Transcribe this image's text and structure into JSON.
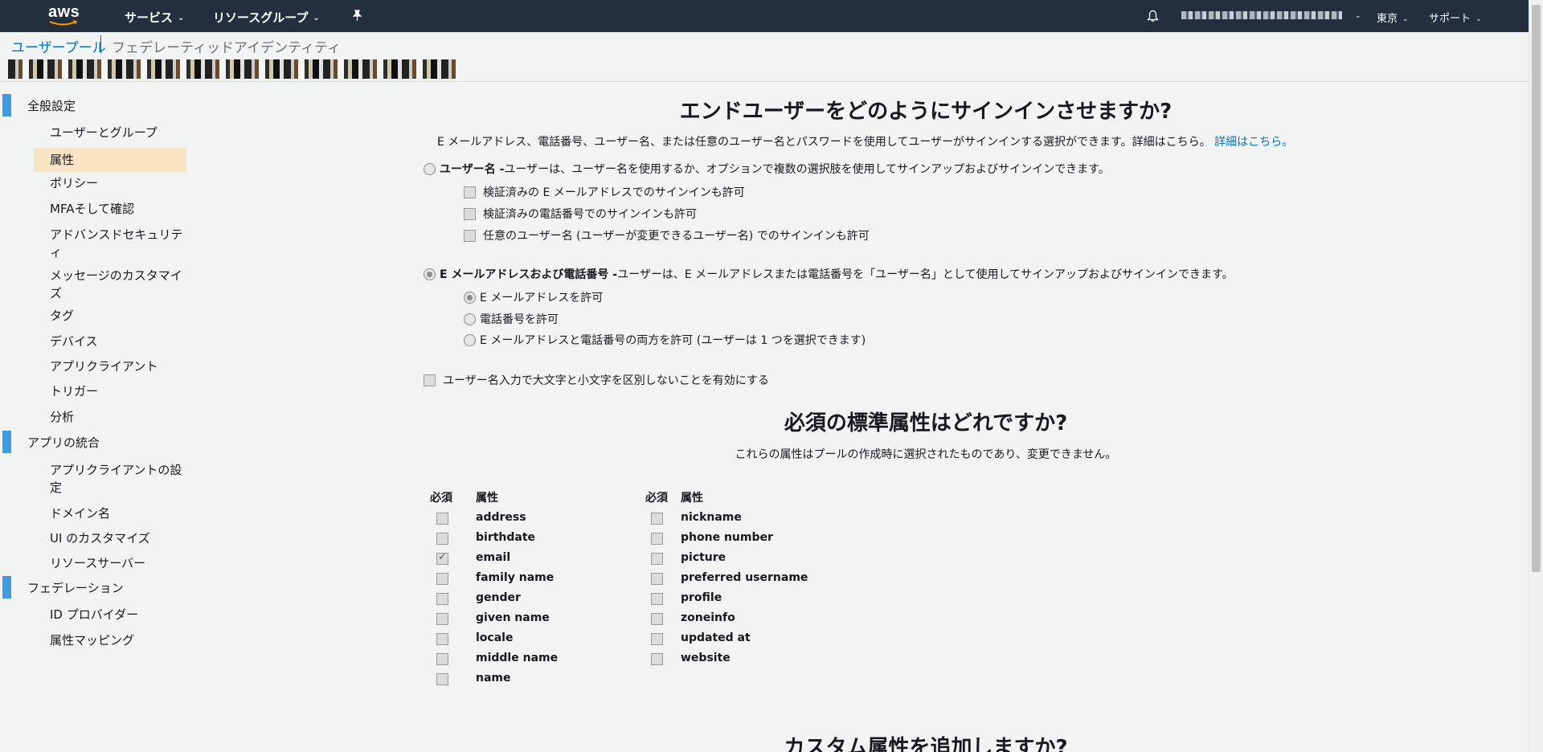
{
  "topnav": {
    "logo_text": "aws",
    "services": "サービス",
    "resource_groups": "リソースグループ",
    "region": "東京",
    "support": "サポート",
    "icons": [
      "pin-icon",
      "bell-icon"
    ]
  },
  "breadcrumb": {
    "user_pools": "ユーザープール",
    "federated_identities": "フェデレーティッドアイデンティティ"
  },
  "sidebar": {
    "group1": "全般設定",
    "group1_items": [
      "ユーザーとグループ",
      "属性",
      "ポリシー",
      "MFAそして確認",
      "アドバンスドセキュリティ",
      "メッセージのカスタマイズ",
      "タグ",
      "デバイス",
      "アプリクライアント",
      "トリガー",
      "分析"
    ],
    "active_item": "属性",
    "group2": "アプリの統合",
    "group2_items": [
      "アプリクライアントの設定",
      "ドメイン名",
      "UI のカスタマイズ",
      "リソースサーバー"
    ],
    "group3": "フェデレーション",
    "group3_items": [
      "ID プロバイダー",
      "属性マッピング"
    ]
  },
  "main": {
    "signin_title": "エンドユーザーをどのようにサインインさせますか?",
    "signin_desc": "E メールアドレス、電話番号、ユーザー名、または任意のユーザー名とパスワードを使用してユーザーがサインインする選択ができます。詳細はこちら。",
    "learn_more": "詳細はこちら。",
    "opt_username_bold": "ユーザー名 -",
    "opt_username_text": " ユーザーは、ユーザー名を使用するか、オプションで複数の選択肢を使用してサインアップおよびサインインできます。",
    "username_subopts": [
      "検証済みの E メールアドレスでのサインインも許可",
      "検証済みの電話番号でのサインインも許可",
      "任意のユーザー名 (ユーザーが変更できるユーザー名) でのサインインも許可"
    ],
    "opt_email_bold": "E メールアドレスおよび電話番号 -",
    "opt_email_text": " ユーザーは、E メールアドレスまたは電話番号を「ユーザー名」として使用してサインアップおよびサインインできます。",
    "email_subopts": [
      "E メールアドレスを許可",
      "電話番号を許可",
      "E メールアドレスと電話番号の両方を許可 (ユーザーは 1 つを選択できます)"
    ],
    "case_insensitive": "ユーザー名入力で大文字と小文字を区別しないことを有効にする",
    "required_title": "必須の標準属性はどれですか?",
    "required_desc": "これらの属性はプールの作成時に選択されたものであり、変更できません。",
    "col_required": "必須",
    "col_attribute": "属性",
    "attrs_left": [
      "address",
      "birthdate",
      "email",
      "family name",
      "gender",
      "given name",
      "locale",
      "middle name",
      "name"
    ],
    "attrs_right": [
      "nickname",
      "phone number",
      "picture",
      "preferred username",
      "profile",
      "zoneinfo",
      "updated at",
      "website"
    ],
    "checked_attr": "email",
    "custom_title": "カスタム属性を追加しますか?"
  }
}
